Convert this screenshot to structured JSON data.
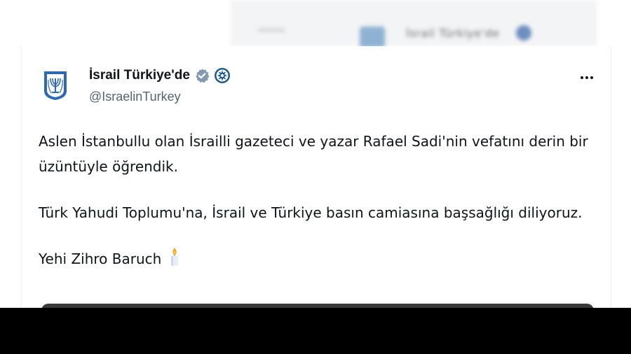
{
  "background_tweet": {
    "blurred_text": "İsrail Türkiye'de"
  },
  "tweet": {
    "display_name": "İsrail Türkiye'de",
    "handle": "@IsraelinTurkey",
    "icons": {
      "avatar": "emblem-of-israel-icon",
      "verified": "verified-badge-icon",
      "affiliation": "government-affiliation-icon",
      "more": "more-options-icon",
      "candle": "candle-emoji-icon"
    },
    "paragraphs": [
      "Aslen İstanbullu olan İsrailli gazeteci ve yazar Rafael Sadi'nin vefatını derin bir üzüntüyle öğrendik.",
      "Türk Yahudi Toplumu'na, İsrail ve Türkiye basın camiasına başsağlığı diliyoruz.",
      "Yehi Zihro Baruch"
    ]
  },
  "colors": {
    "text": "#0f1419",
    "secondary_text": "#536471",
    "verified_gray": "#829aab",
    "affiliation_blue": "#1d5a8f",
    "emblem_blue": "#2b69b4"
  }
}
